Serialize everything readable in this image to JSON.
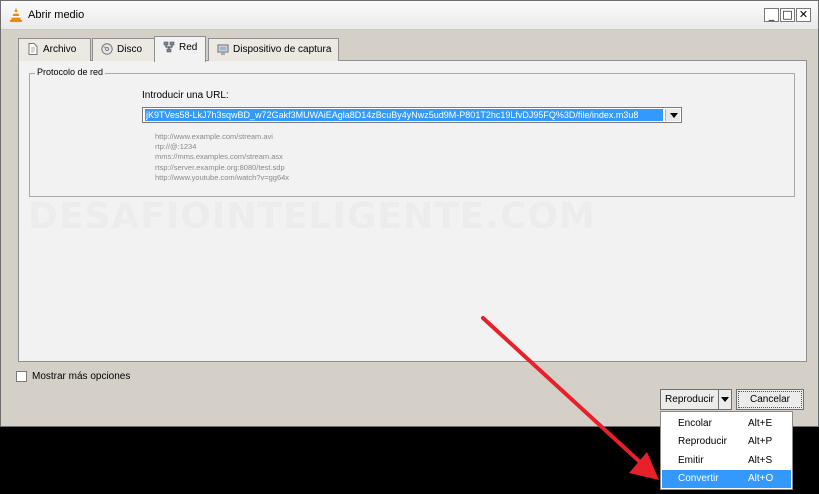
{
  "window": {
    "title": "Abrir medio"
  },
  "tabs": [
    {
      "label": "Archivo",
      "icon": "file-icon"
    },
    {
      "label": "Disco",
      "icon": "disc-icon"
    },
    {
      "label": "Red",
      "icon": "network-icon",
      "active": true
    },
    {
      "label": "Dispositivo de captura",
      "icon": "capture-device-icon"
    }
  ],
  "network": {
    "group_title": "Protocolo de red",
    "url_label": "Introducir una URL:",
    "url_value": "jK9TVes58-LkJ7h3sqwBD_w72Gakf3MUWAiEAgla8D14zBcuBy4yNwz5ud9M-P801T2hc19LfvDJ95FQ%3D/file/index.m3u8",
    "examples": [
      "http://www.example.com/stream.avi",
      "rtp://@:1234",
      "mms://mms.examples.com/stream.asx",
      "rtsp://server.example.org:8080/test.sdp",
      "http://www.youtube.com/watch?v=gg64x"
    ]
  },
  "watermark": "DESAFIOINTELIGENTE.COM",
  "options": {
    "more_options_label": "Mostrar más opciones"
  },
  "buttons": {
    "play": "Reproducir",
    "cancel": "Cancelar"
  },
  "menu": {
    "items": [
      {
        "label": "Encolar",
        "shortcut": "Alt+E"
      },
      {
        "label": "Reproducir",
        "shortcut": "Alt+P"
      },
      {
        "label": "Emitir",
        "shortcut": "Alt+S"
      },
      {
        "label": "Convertir",
        "shortcut": "Alt+O",
        "selected": true
      }
    ]
  },
  "colors": {
    "selection": "#3399ff",
    "annotation_arrow": "#e8202a",
    "vlc_orange": "#f08a00"
  }
}
